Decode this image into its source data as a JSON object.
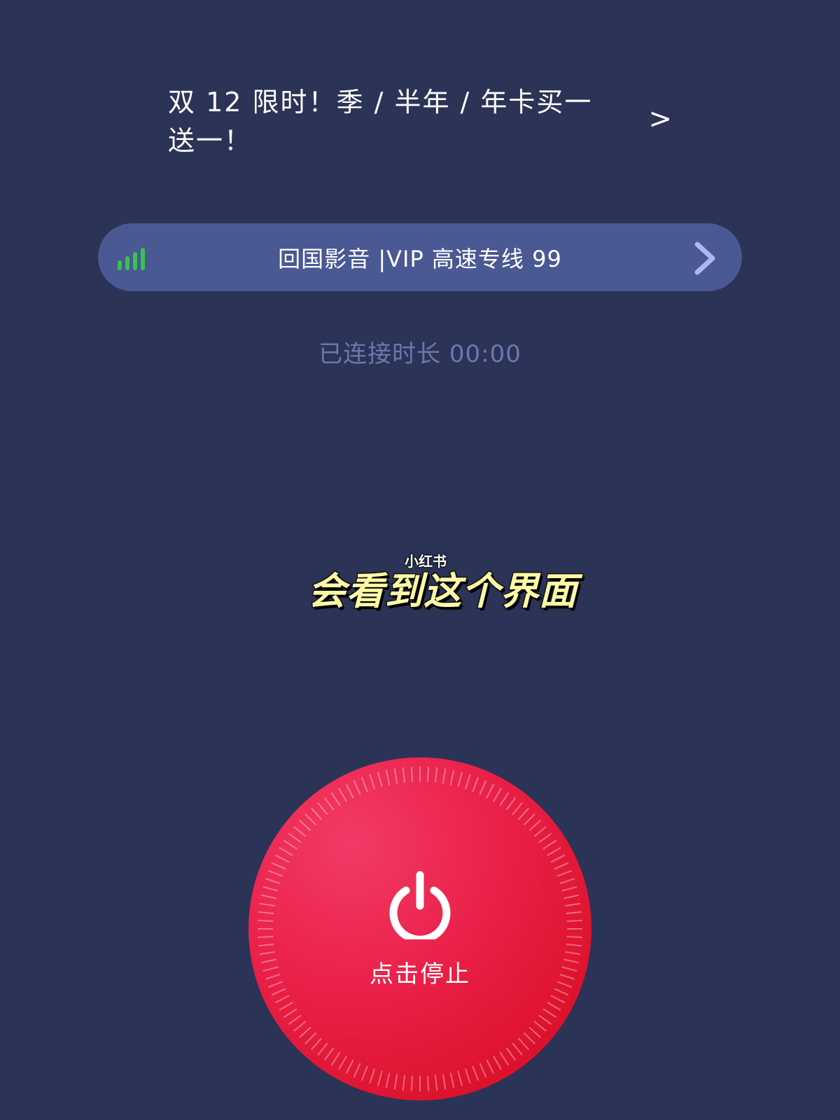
{
  "promo": {
    "text": "双 12 限时！季 / 半年 / 年卡买一送一！",
    "arrow": ">"
  },
  "server": {
    "name": "回国影音 |VIP 高速专线 99",
    "signal_icon": "signal-bars-icon",
    "chevron_icon": "chevron-right-icon",
    "signal_color": "#39c24d"
  },
  "status": {
    "duration_label": "已连接时长 00:00"
  },
  "overlay": {
    "watermark": "小红书",
    "caption": "会看到这个界面"
  },
  "power_button": {
    "label": "点击停止",
    "icon": "power-icon",
    "colors": {
      "top": "#f23a66",
      "bottom": "#d40a1a"
    }
  },
  "theme": {
    "background": "#2b3356",
    "pill": "#4a5893",
    "muted_text": "#6b78ad"
  }
}
